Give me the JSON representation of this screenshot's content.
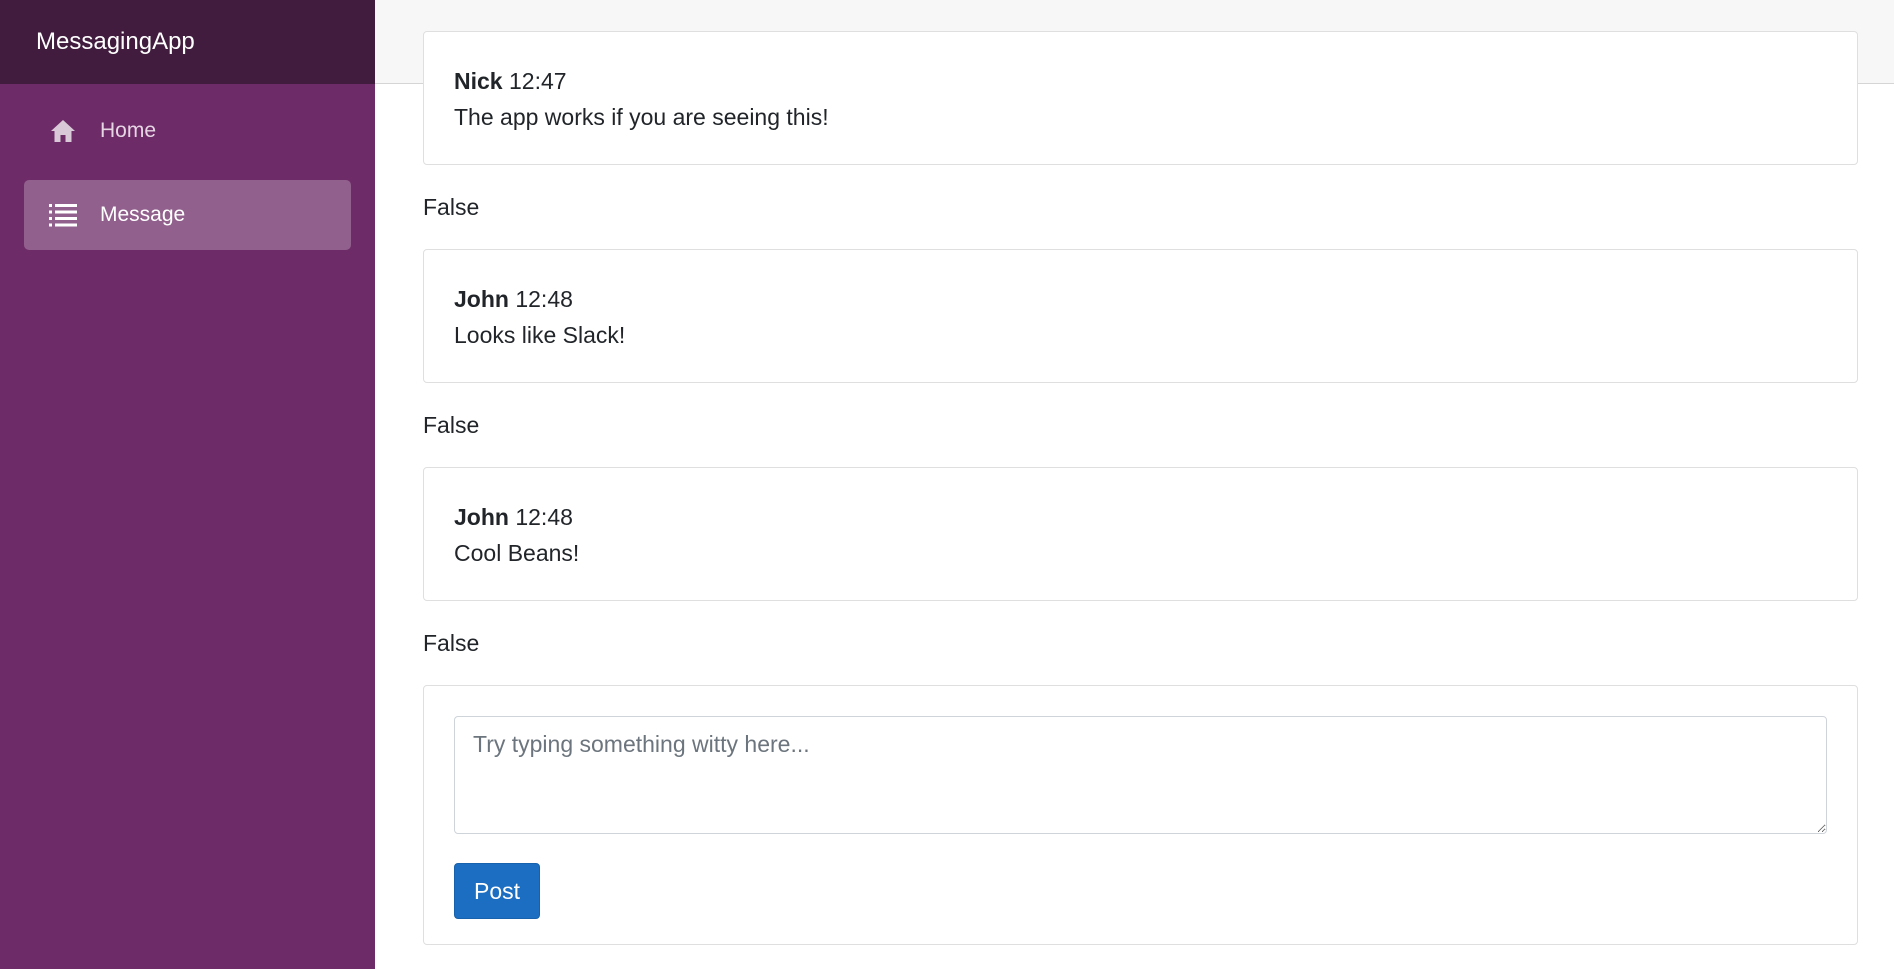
{
  "app": {
    "brand": "MessagingApp"
  },
  "sidebar": {
    "items": [
      {
        "label": "Home",
        "icon": "home-icon",
        "active": false
      },
      {
        "label": "Message",
        "icon": "list-icon",
        "active": true
      }
    ]
  },
  "messages": [
    {
      "author": "Nick",
      "time": "12:47",
      "text": "The app works if you are seeing this!",
      "flag": "False"
    },
    {
      "author": "John",
      "time": "12:48",
      "text": "Looks like Slack!",
      "flag": "False"
    },
    {
      "author": "John",
      "time": "12:48",
      "text": "Cool Beans!",
      "flag": "False"
    }
  ],
  "compose": {
    "placeholder": "Try typing something witty here...",
    "value": "",
    "post_label": "Post"
  },
  "colors": {
    "sidebar": "#6d2b67",
    "brand_bar": "#411c3e",
    "primary": "#1b6ec2"
  }
}
